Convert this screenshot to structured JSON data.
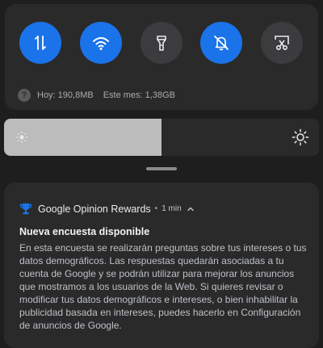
{
  "quick_settings": {
    "tiles": [
      {
        "icon": "mobile-data-icon",
        "active": true
      },
      {
        "icon": "wifi-icon",
        "active": true
      },
      {
        "icon": "flashlight-icon",
        "active": false
      },
      {
        "icon": "do-not-disturb-bell-off-icon",
        "active": true
      },
      {
        "icon": "screenshot-scissors-icon",
        "active": false
      }
    ],
    "data_usage": {
      "today": "Hoy: 190,8MB",
      "month": "Este mes: 1,38GB"
    },
    "brightness_level": 0.5
  },
  "notification": {
    "app_name": "Google Opinion Rewards",
    "separator": "•",
    "time": "1 min",
    "title": "Nueva encuesta disponible",
    "body": "En esta encuesta se realizarán preguntas sobre tus intereses o tus datos demográficos. Las respuestas quedarán asociadas a tu cuenta de Google y se podrán utilizar para mejorar los anuncios que mostramos a los usuarios de la Web. Si quieres revisar o modificar tus datos demográficos e intereses, o bien inhabilitar la publicidad basada en intereses, puedes hacerlo en Configuración de anuncios de Google."
  },
  "colors": {
    "accent": "#1a73e8",
    "tile_off": "#3c3c3e",
    "app_icon": "#1a73e8"
  }
}
